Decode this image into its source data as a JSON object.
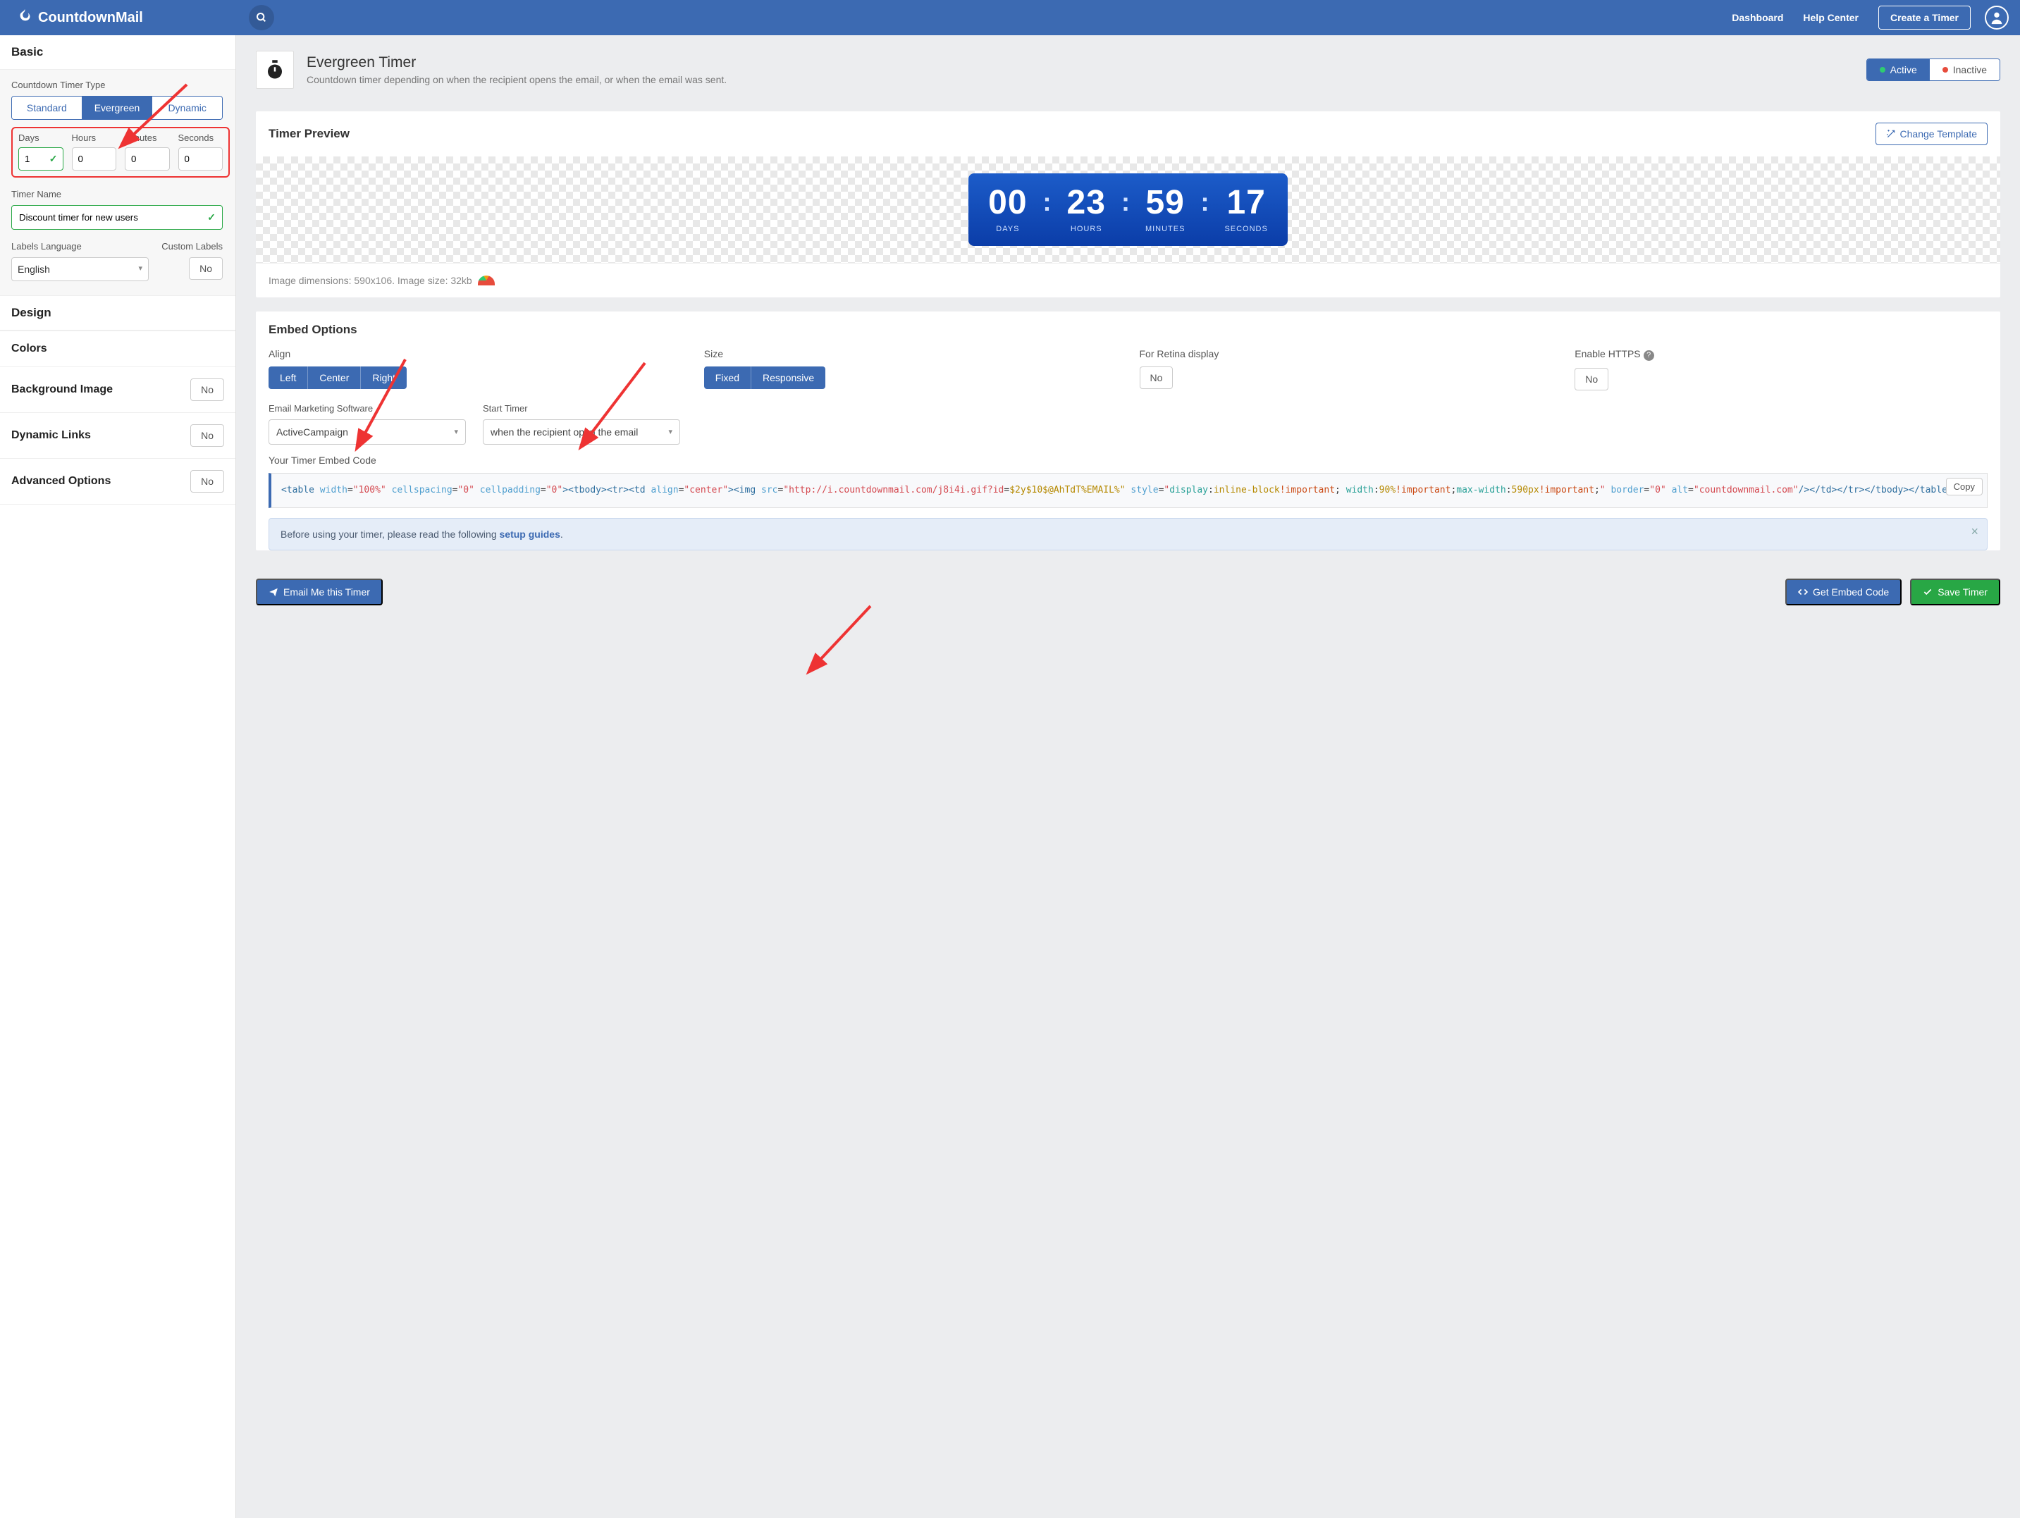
{
  "header": {
    "brand": "CountdownMail",
    "nav_dashboard": "Dashboard",
    "nav_help": "Help Center",
    "create_timer": "Create a Timer"
  },
  "sidebar": {
    "basic": "Basic",
    "timer_type_label": "Countdown Timer Type",
    "types": [
      "Standard",
      "Evergreen",
      "Dynamic"
    ],
    "time_labels": [
      "Days",
      "Hours",
      "Minutes",
      "Seconds"
    ],
    "time_values": [
      "1",
      "0",
      "0",
      "0"
    ],
    "timer_name_label": "Timer Name",
    "timer_name_value": "Discount timer for new users",
    "labels_lang_label": "Labels Language",
    "custom_labels_label": "Custom Labels",
    "lang_value": "English",
    "custom_labels_btn": "No",
    "design": "Design",
    "colors": "Colors",
    "bg_image": "Background Image",
    "bg_image_btn": "No",
    "dyn_links": "Dynamic Links",
    "dyn_links_btn": "No",
    "adv_opts": "Advanced Options",
    "adv_opts_btn": "No"
  },
  "page": {
    "title": "Evergreen Timer",
    "subtitle": "Countdown timer depending on when the recipient opens the email, or when the email was sent.",
    "status_active": "Active",
    "status_inactive": "Inactive"
  },
  "preview": {
    "title": "Timer Preview",
    "change_template": "Change Template",
    "timer": {
      "days_v": "00",
      "days_l": "DAYS",
      "hours_v": "23",
      "hours_l": "HOURS",
      "mins_v": "59",
      "mins_l": "MINUTES",
      "secs_v": "17",
      "secs_l": "SECONDS"
    },
    "img_info": "Image dimensions: 590x106. Image size: 32kb"
  },
  "embed": {
    "title": "Embed Options",
    "align_label": "Align",
    "align_opts": [
      "Left",
      "Center",
      "Right"
    ],
    "size_label": "Size",
    "size_opts": [
      "Fixed",
      "Responsive"
    ],
    "retina_label": "For Retina display",
    "retina_btn": "No",
    "https_label": "Enable HTTPS",
    "https_btn": "No",
    "ems_label": "Email Marketing Software",
    "ems_value": "ActiveCampaign",
    "start_label": "Start Timer",
    "start_value": "when the recipient open the email",
    "code_label": "Your Timer Embed Code",
    "copy": "Copy",
    "code_url": "http://i.countdownmail.com/j8i4i.gif?id",
    "code_idval": "$2y$10$@AhTdT%EMAIL%",
    "code_alt": "countdownmail.com",
    "alert_pre": "Before using your timer, please read the following ",
    "alert_link": "setup guides",
    "alert_post": "."
  },
  "footer": {
    "email_me": "Email Me this Timer",
    "get_embed": "Get Embed Code",
    "save": "Save Timer"
  }
}
